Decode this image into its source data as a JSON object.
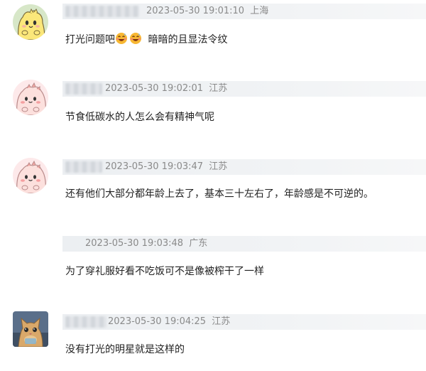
{
  "comments": [
    {
      "avatar": "yellow-dinosaur-avatar",
      "timestamp": "2023-05-30 19:01:10",
      "location": "上海",
      "text_before": "打光问题吧",
      "emoji": "grinning-sweat-emoji",
      "text_after": "暗暗的且显法令纹"
    },
    {
      "avatar": "pink-dinosaur-avatar",
      "timestamp": "2023-05-30 19:02:01",
      "location": "江苏",
      "text": "节食低碳水的人怎么会有精神气呢"
    },
    {
      "avatar": "pink-dinosaur-avatar",
      "timestamp": "2023-05-30 19:03:47",
      "location": "江苏",
      "text": "还有他们大部分都年龄上去了，基本三十左右了，年龄感是不可逆的。"
    },
    {
      "avatar": "",
      "timestamp": "2023-05-30 19:03:48",
      "location": "广东",
      "text": "为了穿礼服好看不吃饭可不是像被榨干了一样"
    },
    {
      "avatar": "cat-photo-avatar",
      "timestamp": "2023-05-30 19:04:25",
      "location": "江苏",
      "text": "没有打光的明星就是这样的"
    }
  ]
}
